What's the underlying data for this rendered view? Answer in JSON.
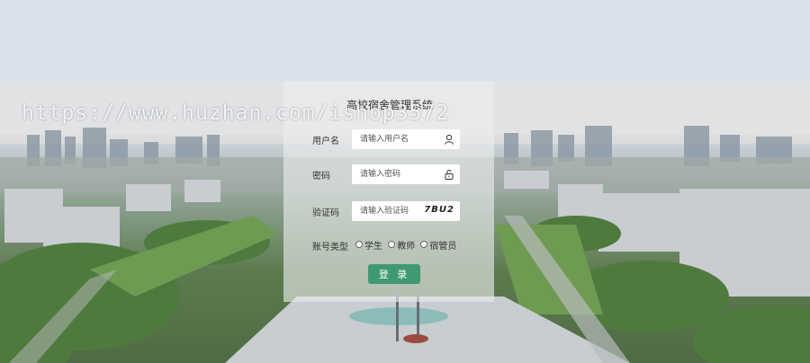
{
  "watermark": "https://www.huzhan.com/ishop3572",
  "login": {
    "title": "高校宿舍管理系统",
    "username": {
      "label": "用户名",
      "placeholder": "请输入用户名",
      "icon": "user-icon"
    },
    "password": {
      "label": "密码",
      "placeholder": "请输入密码",
      "icon": "lock-icon"
    },
    "captcha": {
      "label": "验证码",
      "placeholder": "请输入验证码",
      "code": "7BU2"
    },
    "account_type": {
      "label": "账号类型",
      "options": [
        "学生",
        "教师",
        "宿管员"
      ]
    },
    "submit_label": "登 录"
  },
  "colors": {
    "accent": "#3f9a72",
    "panel_bg": "#ebeeee"
  }
}
